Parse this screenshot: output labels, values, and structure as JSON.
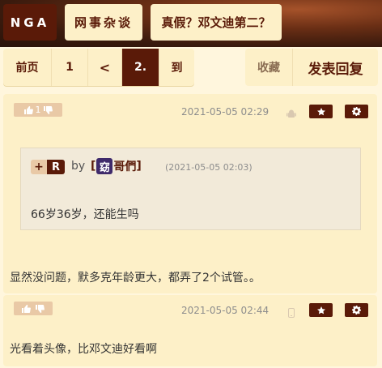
{
  "header": {
    "logo": "NGA",
    "breadcrumb_forum": "网事杂谈",
    "breadcrumb_thread": "真假？邓文迪第二？"
  },
  "pager": {
    "prev": "前页",
    "page1": "1",
    "prev_arrow": "<",
    "current": "2.",
    "goto": "到"
  },
  "actions": {
    "favorite": "收藏",
    "reply": "发表回复"
  },
  "posts": [
    {
      "vote_count": "1",
      "timestamp": "2021-05-05 02:29",
      "device_icon": "android-icon",
      "quote": {
        "plus": "+",
        "r": "R",
        "by": "by",
        "user_bracket_open": "[",
        "user_avatar_char": "窈",
        "user_name": "哥們",
        "user_bracket_close": "]",
        "time": "(2021-05-05 02:03)",
        "text": "66岁36岁，还能生吗"
      },
      "body": "显然没问题，默多克年龄更大，都弄了2个试管。。"
    },
    {
      "vote_count": "",
      "timestamp": "2021-05-05 02:44",
      "device_icon": "phone-icon",
      "body": "光看着头像，比邓文迪好看啊"
    }
  ],
  "colors": {
    "brand": "#5a1a08",
    "panel": "#fdf0c8",
    "background": "#fff6dd"
  }
}
